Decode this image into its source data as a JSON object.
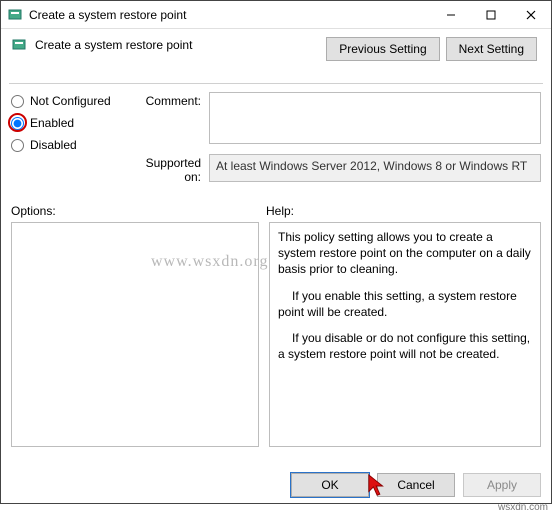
{
  "window": {
    "title": "Create a system restore point"
  },
  "header": {
    "title": "Create a system restore point",
    "prev_setting": "Previous Setting",
    "next_setting": "Next Setting"
  },
  "radios": {
    "not_configured": "Not Configured",
    "enabled": "Enabled",
    "disabled": "Disabled",
    "selected": "enabled"
  },
  "fields": {
    "comment_label": "Comment:",
    "comment_value": "",
    "supported_label": "Supported on:",
    "supported_value": "At least Windows Server 2012, Windows 8 or Windows RT"
  },
  "lower": {
    "options_label": "Options:",
    "help_label": "Help:"
  },
  "help": {
    "p1": "This policy setting allows you to create a system restore point on the computer on a daily basis prior to cleaning.",
    "p2": "If you enable this setting, a system restore point will be created.",
    "p3": "If you disable or do not configure this setting, a system restore point will not be created."
  },
  "footer": {
    "ok": "OK",
    "cancel": "Cancel",
    "apply": "Apply"
  },
  "credit": "wsxdn.com",
  "watermark": "www.wsxdn.org"
}
